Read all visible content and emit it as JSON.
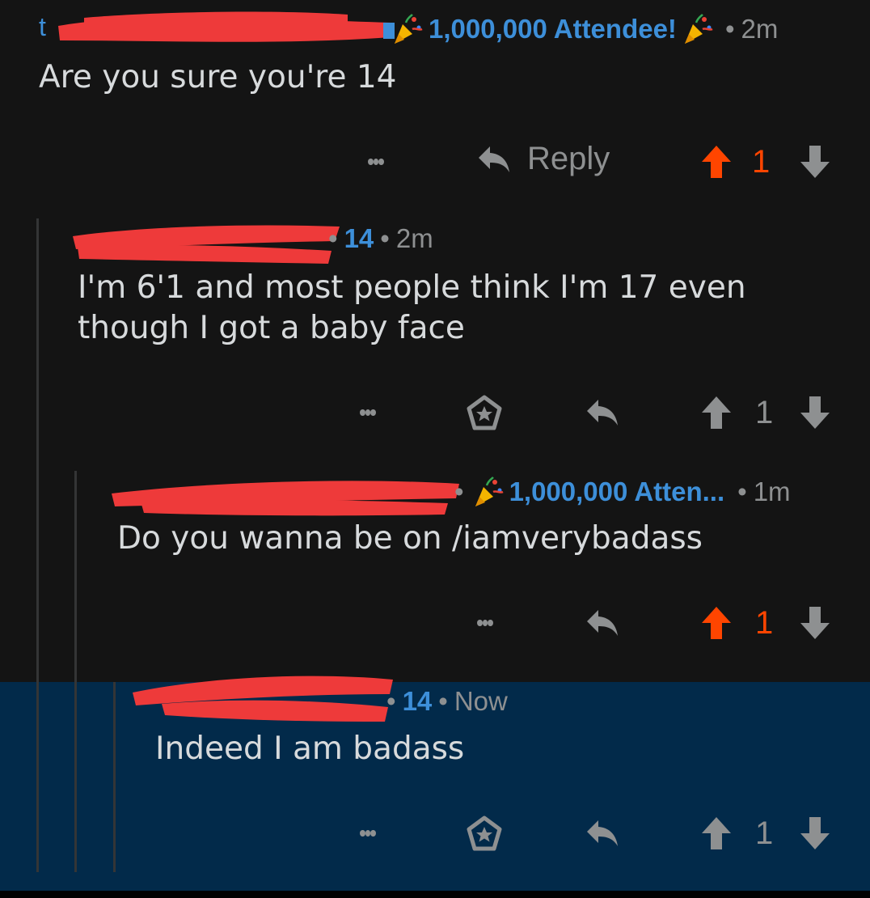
{
  "comments": [
    {
      "flair": "1,000,000 Attendee!",
      "time": "2m",
      "body": "Are you sure you're 14",
      "reply_label": "Reply",
      "score": "1",
      "upvoted": true
    },
    {
      "flair": "14",
      "time": "2m",
      "body_lines": [
        "I'm 6'1 and most people think I'm 17 even",
        "though I got a baby face"
      ],
      "score": "1",
      "upvoted": false
    },
    {
      "flair": "1,000,000 Atten...",
      "time": "1m",
      "body": "Do you wanna be on /iamverybadass",
      "score": "1",
      "upvoted": true
    },
    {
      "flair": "14",
      "time": "Now",
      "body": "Indeed I am badass",
      "score": "1",
      "upvoted": false,
      "highlighted": true
    }
  ],
  "separator": "•",
  "colors": {
    "background": "#141414",
    "highlight": "#022a4a",
    "upvote": "#ff4500",
    "flair": "#3d8fd9",
    "muted": "#8e9091",
    "text": "#d7dadc",
    "redaction": "#ee3a3a"
  },
  "icons": {
    "more": "more-vertical-icon",
    "reply": "reply-arrow-icon",
    "award": "award-icon",
    "upvote": "upvote-arrow-icon",
    "downvote": "downvote-arrow-icon",
    "party": "party-popper-icon"
  }
}
